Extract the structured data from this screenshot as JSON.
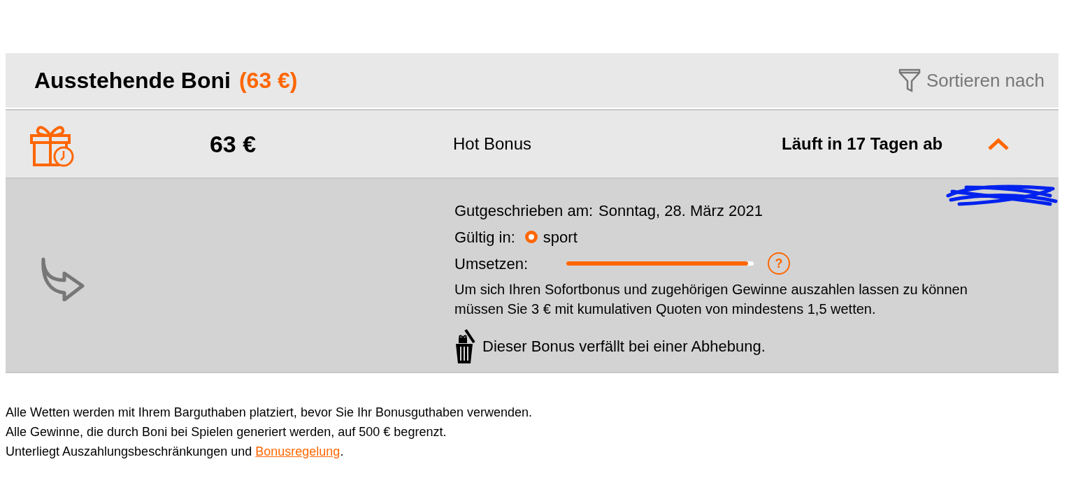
{
  "header": {
    "title": "Ausstehende Boni",
    "total": "(63 €)",
    "sort_label": "Sortieren nach"
  },
  "bonuses": [
    {
      "amount": "63 €",
      "name": "Hot Bonus",
      "expiry": "Läuft in 17 Tagen ab",
      "expanded": true,
      "details": {
        "credited_label": "Gutgeschrieben am:",
        "credited_value": "Sonntag, 28. März 2021",
        "valid_label": "Gültig in:",
        "valid_options": [
          {
            "label": "sport",
            "selected": true
          }
        ],
        "wager": {
          "label": "Umsetzen:",
          "level": 0.97
        },
        "help": "?",
        "description": "Um sich Ihren Sofortbonus und zugehörigen Gewinne auszahlen lassen zu können müssen Sie 3 € mit kumulativen Quoten von mindestens 1,5 wetten.",
        "forfeit": "Dieser Bonus verfällt bei einer Abhebung."
      }
    }
  ],
  "footer": {
    "lines": [
      "Alle Wetten werden mit Ihrem Barguthaben platziert, bevor Sie Ihr Bonusguthaben verwenden.",
      "Alle Gewinne, die durch Boni bei Spielen generiert werden, auf 500 € begrenzt."
    ],
    "terms_prefix": "Unterliegt Auszahlungsbeschränkungen und",
    "terms_link": "Bonusregelung",
    "terms_suffix": "."
  }
}
